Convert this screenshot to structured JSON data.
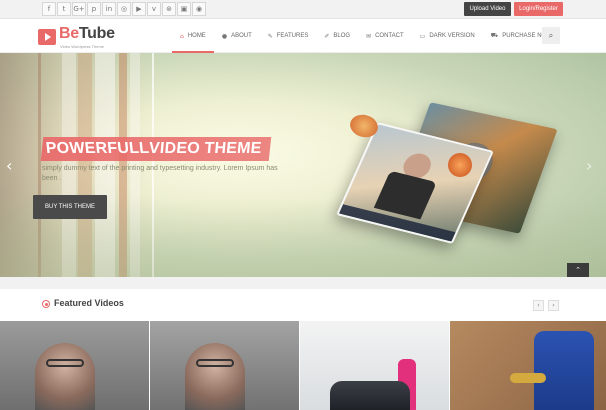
{
  "topbar": {
    "social": [
      {
        "icon": "facebook-icon",
        "glyph": "f"
      },
      {
        "icon": "twitter-icon",
        "glyph": "t"
      },
      {
        "icon": "google-plus-icon",
        "glyph": "G+"
      },
      {
        "icon": "pinterest-icon",
        "glyph": "p"
      },
      {
        "icon": "linkedin-icon",
        "glyph": "in"
      },
      {
        "icon": "instagram-icon",
        "glyph": "◎"
      },
      {
        "icon": "youtube-icon",
        "glyph": "▶"
      },
      {
        "icon": "vimeo-icon",
        "glyph": "v"
      },
      {
        "icon": "dribbble-icon",
        "glyph": "⊛"
      },
      {
        "icon": "flickr-icon",
        "glyph": "▣"
      },
      {
        "icon": "github-icon",
        "glyph": "◉"
      }
    ],
    "upload_label": "Upload Video",
    "login_label": "Login/Register"
  },
  "header": {
    "logo_be": "Be",
    "logo_tube": "Tube",
    "logo_tagline": "Video Wordpress Theme",
    "nav": [
      {
        "label": "HOME",
        "icon": "home-icon",
        "glyph": "⌂",
        "active": true
      },
      {
        "label": "ABOUT",
        "icon": "user-icon",
        "glyph": "●",
        "active": false
      },
      {
        "label": "FEATURES",
        "icon": "pencil-icon",
        "glyph": "✎",
        "active": false
      },
      {
        "label": "BLOG",
        "icon": "edit-icon",
        "glyph": "✐",
        "active": false
      },
      {
        "label": "CONTACT",
        "icon": "envelope-icon",
        "glyph": "✉",
        "active": false
      },
      {
        "label": "DARK VERSION",
        "icon": "monitor-icon",
        "glyph": "▭",
        "active": false
      },
      {
        "label": "PURCHASE NOW",
        "icon": "cart-icon",
        "glyph": "⛟",
        "active": false
      }
    ],
    "search_glyph": "⌕"
  },
  "hero": {
    "title_plain": "POWERFULL ",
    "title_italic": "VIDEO THEME",
    "description": "simply dummy text of the printing and typesetting industry. Lorem Ipsum has been .",
    "button_label": "BUY THIS THEME",
    "arrow_left": "‹",
    "arrow_right": "›",
    "scroll_top": "⌃"
  },
  "featured": {
    "title": "Featured Videos",
    "prev": "‹",
    "next": "›"
  },
  "colors": {
    "accent": "#e96969",
    "dark_button": "#444444",
    "text": "#444444"
  }
}
